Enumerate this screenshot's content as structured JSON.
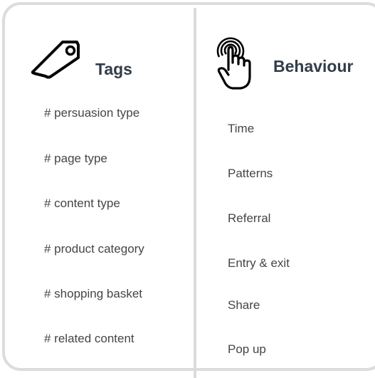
{
  "tags": {
    "title": "Tags",
    "icon": "tag-icon",
    "items": [
      "# persuasion type",
      "# page type",
      "# content type",
      "# product category",
      "# shopping basket",
      "# related content"
    ]
  },
  "behaviour": {
    "title": "Behaviour",
    "icon": "touch-hand-icon",
    "items": [
      "Time",
      "Patterns",
      "Referral",
      "Entry & exit",
      "Share",
      "Pop up"
    ]
  },
  "colors": {
    "border": "#dcdcdc",
    "heading": "#333d4a",
    "text": "#454545",
    "icon": "#000000"
  }
}
